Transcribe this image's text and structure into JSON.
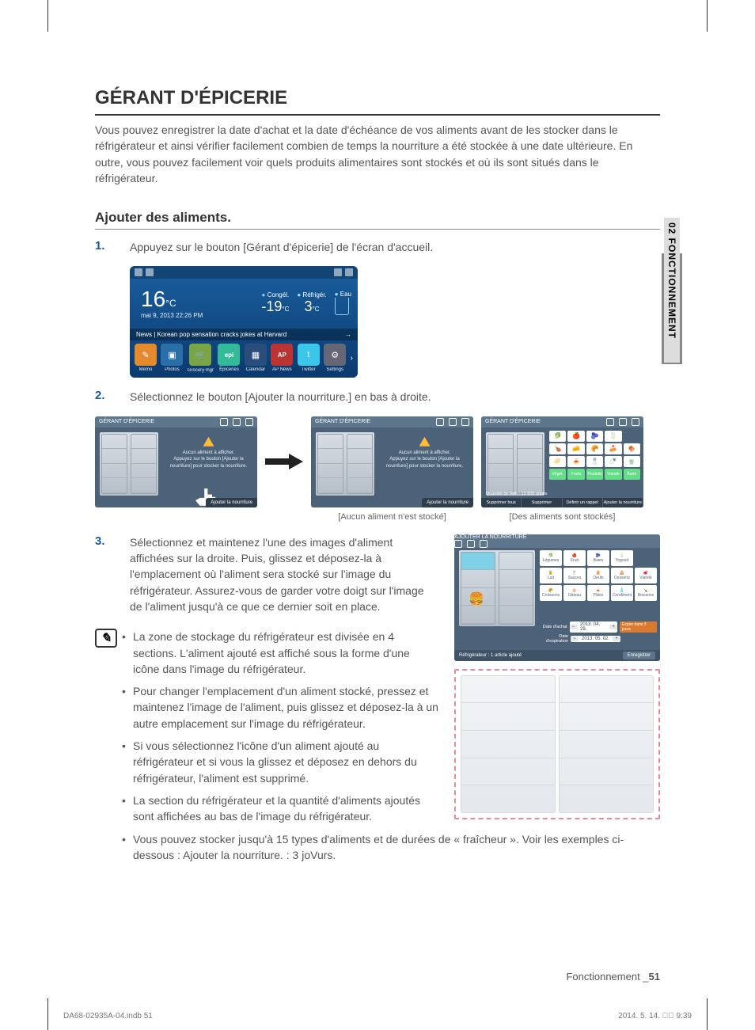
{
  "sideTab": "02  FONCTIONNEMENT",
  "title": "GÉRANT D'ÉPICERIE",
  "intro": "Vous pouvez enregistrer la date d'achat et la date d'échéance de vos aliments avant de les stocker dans le réfrigérateur et ainsi vérifier facilement combien de temps la nourriture a été stockée à une date ultérieure. En outre, vous pouvez facilement voir quels produits alimentaires sont stockés et où ils sont situés dans le réfrigérateur.",
  "subheading": "Ajouter des aliments.",
  "steps": {
    "s1": {
      "num": "1.",
      "text": "Appuyez sur le bouton [Gérant d'épicerie] de l'écran d'accueil."
    },
    "s2": {
      "num": "2.",
      "text": "Sélectionnez le bouton [Ajouter la nourriture.] en bas à droite."
    },
    "s3": {
      "num": "3.",
      "text": "Sélectionnez et maintenez l'une des images d'aliment affichées sur la droite. Puis, glissez et déposez-la à l'emplacement où l'aliment sera stocké sur l'image du réfrigérateur. Assurez-vous de garder votre doigt sur l'image de l'aliment jusqu'à ce que ce dernier soit en place."
    }
  },
  "bullets": {
    "b1": "La zone de stockage du réfrigérateur est divisée en 4 sections. L'aliment ajouté est affiché sous la forme d'une icône dans l'image du réfrigérateur.",
    "b2": "Pour changer l'emplacement d'un aliment stocké, pressez et maintenez l'image de l'aliment, puis glissez et déposez-la à un autre emplacement sur l'image du réfrigérateur.",
    "b3": "Si vous sélectionnez l'icône d'un aliment ajouté au réfrigérateur et si vous la glissez et déposez en dehors du réfrigérateur, l'aliment est supprimé.",
    "b4": "La section du réfrigérateur et la quantité d'aliments ajoutés sont affichées au bas de l'image du réfrigérateur.",
    "b5": "Vous pouvez stocker jusqu'à 15 types d'aliments et de durées de « fraîcheur ». Voir les exemples ci-dessous : Ajouter la nourriture. : 3 joVurs."
  },
  "home": {
    "temp": "16",
    "tempUnit": "°C",
    "date": "mai 9, 2013 22:26 PM",
    "freezerLabel": "Congél.",
    "freezerVal": "-19",
    "fridgeLabel": "Réfrigér.",
    "fridgeVal": "3",
    "waterLabel": "Eau",
    "news": "News | Korean pop sensation cracks jokes at Harvard",
    "apps": [
      "Memo",
      "Photos",
      "Groceryᐧmgr",
      "Épiceries",
      "Calendar",
      "AP News",
      "Twitter",
      "Settings"
    ]
  },
  "panels": {
    "title": "GÉRANT D'ÉPICERIE",
    "emptyHeader": "Aucun aliment à afficher.",
    "emptyBody": "Appuyez sur le bouton [Ajouter la nourriture] pour stocker la nourriture.",
    "addBtn": "Ajouter la nourriture",
    "btnDeleteAll": "Supprimer tous",
    "btnDelete": "Supprimer",
    "btnReminder": "Définir un rappel",
    "btnAdd": "Ajouter la nourriture",
    "gridStatus": "Quantité de Réf. : 12 800 unités"
  },
  "captions": {
    "c2": "[Aucun aliment n'est stocké]",
    "c3": "[Des aliments sont stockés]"
  },
  "addFood": {
    "title": "AJOUTER LA NOURRITURE",
    "cats": [
      "Légumes",
      "Fruit",
      "Baies",
      "Yogourt",
      "Lait",
      "Sauces",
      "Oeufs",
      "Desserts",
      "Viande",
      "Croissons",
      "Gâteau",
      "Pâtes",
      "Condiment",
      "Boissons"
    ],
    "dateBuy": "Date d'achat",
    "dateExp": "Date d'expiration",
    "valBuy": "2013. 04. 29.",
    "valExp": "2013. 05. 02.",
    "expiresIn": "Expire dans 3 jours",
    "status": "Réfrigérateur : 1 article ajouté",
    "save": "Enregistrer"
  },
  "footer": {
    "section": "Fonctionnement",
    "page": "51"
  },
  "printmark": {
    "left": "DA68-02935A-04.indb   51",
    "right": "2014. 5. 14.   \u0000\u0000 9:39"
  }
}
